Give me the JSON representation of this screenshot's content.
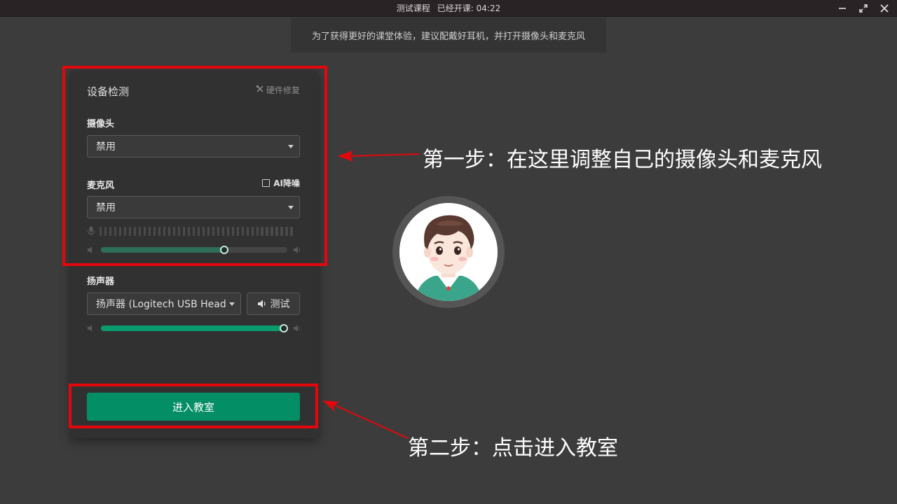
{
  "titlebar": {
    "course": "测试课程",
    "status": "已经开课: 04:22"
  },
  "tip": "为了获得更好的课堂体验，建议配戴好耳机，并打开摄像头和麦克风",
  "panel": {
    "title": "设备检测",
    "repair": "硬件修复",
    "camera": {
      "label": "摄像头",
      "selected": "禁用"
    },
    "microphone": {
      "label": "麦克风",
      "ai_noise": "AI降噪",
      "ai_noise_checked": false,
      "selected": "禁用",
      "volume_percent": 66
    },
    "speaker": {
      "label": "扬声器",
      "selected": "扬声器 (Logitech USB Head",
      "test_label": "测试",
      "volume_percent": 98
    },
    "enter_button": "进入教室"
  },
  "annotations": {
    "step1": "第一步：在这里调整自己的摄像头和麦克风",
    "step2": "第二步：点击进入教室"
  },
  "colors": {
    "accent": "#048e65",
    "highlight": "#e3070c",
    "mic_fill": "#2f6e58",
    "speaker_fill": "#0a9a6d"
  },
  "icons": {
    "minimize": "minimize-icon",
    "restore": "restore-icon",
    "close": "close-icon",
    "repair": "wrench-icon",
    "mic": "microphone-icon",
    "speaker": "speaker-icon"
  }
}
